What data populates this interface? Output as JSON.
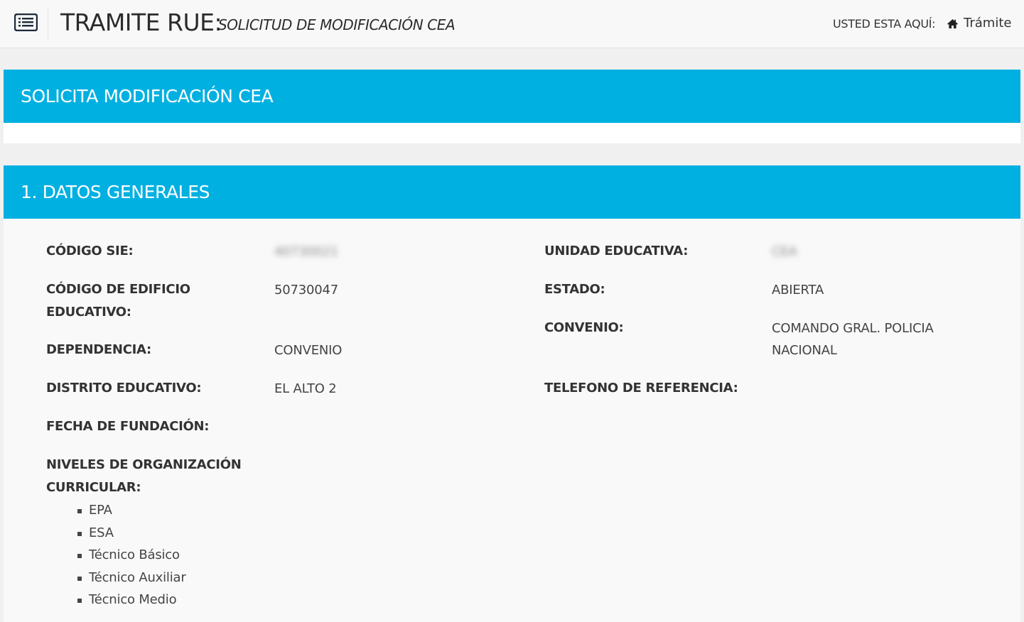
{
  "header": {
    "title": "TRAMITE RUE:",
    "subtitle": "SOLICITUD DE MODIFICACIÓN CEA",
    "breadcrumb_label": "USTED ESTA AQUÍ:",
    "breadcrumb_link": "Trámite",
    "menu_icon": "list-icon",
    "home_icon": "home-icon"
  },
  "banner_request": "SOLICITA MODIFICACIÓN CEA",
  "section": {
    "title": "1. DATOS GENERALES"
  },
  "fields": {
    "codigo_sie": {
      "label": "CÓDIGO SIE:",
      "value": "40730021"
    },
    "codigo_edificio": {
      "label": "CÓDIGO DE EDIFICIO EDUCATIVO:",
      "value": "50730047"
    },
    "dependencia": {
      "label": "DEPENDENCIA:",
      "value": "CONVENIO"
    },
    "distrito": {
      "label": "DISTRITO EDUCATIVO:",
      "value": "EL ALTO 2"
    },
    "fecha_fundacion": {
      "label": "FECHA DE FUNDACIÓN:",
      "value": ""
    },
    "niveles": {
      "label": "NIVELES DE ORGANIZACIÓN CURRICULAR:"
    },
    "unidad_educativa": {
      "label": "UNIDAD EDUCATIVA:",
      "value": "CEA"
    },
    "estado": {
      "label": "ESTADO:",
      "value": "ABIERTA"
    },
    "convenio": {
      "label": "CONVENIO:",
      "value": "COMANDO GRAL. POLICIA NACIONAL"
    },
    "telefono": {
      "label": "TELEFONO DE REFERENCIA:",
      "value": ""
    }
  },
  "levels": [
    "EPA",
    "ESA",
    "Técnico Básico",
    "Técnico Auxiliar",
    "Técnico Medio"
  ],
  "colors": {
    "accent": "#00b0e1",
    "header_bg": "#f8f8f8",
    "page_bg": "#f0f0f0",
    "panel_bg": "#f9f9f9"
  }
}
